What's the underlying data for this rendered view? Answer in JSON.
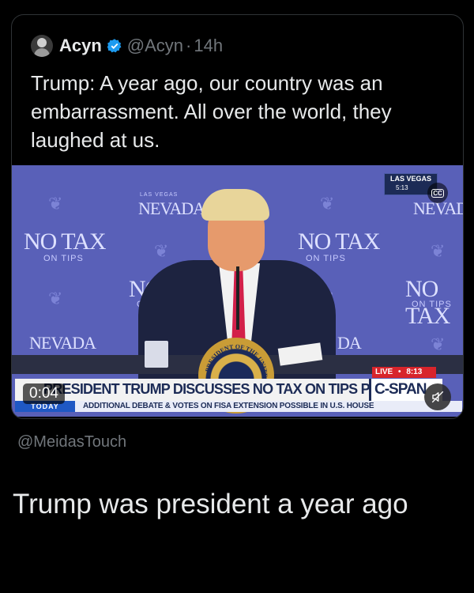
{
  "tweet": {
    "author_name": "Acyn",
    "handle": "@Acyn",
    "separator": "·",
    "time_ago": "14h",
    "text": "Trump: A year ago, our country was an embarrassment. All over the world, they laughed at us."
  },
  "video": {
    "duration": "0:04",
    "background_texts": {
      "nevada_left": "NEVADA",
      "nevada_right": "NEVADA",
      "nevada_bottom_left": "NEVADA",
      "las_vegas_small": "LAS VEGAS",
      "no_tax_left": "NO TAX",
      "no_tax_center": "NO TAX",
      "no_tax_right": "NO TAX",
      "on_tips": "ON TIPS",
      "no_partial": "NO",
      "on_partial": "ON",
      "da_partial": "DA"
    },
    "location_bug": {
      "city": "LAS VEGAS",
      "time": "5:13"
    },
    "cc_label": "CC",
    "live_tag": {
      "label": "LIVE",
      "dot": "•",
      "time": "8:13"
    },
    "chyron": "PRESIDENT TRUMP DISCUSSES NO TAX ON TIPS POLICY",
    "network": "C-SPAN",
    "ticker_tag": "TODAY",
    "ticker_text": "ADDITIONAL DEBATE & VOTES ON FISA EXTENSION POSSIBLE IN U.S. HOUSE",
    "seal_text": "PRESIDENT OF THE UNITED"
  },
  "attribution": "@MeidasTouch",
  "comment": "Trump was president a year ago",
  "colors": {
    "verified_blue": "#1d9bf0",
    "muted_text": "#71767b",
    "card_border": "#2f3336"
  }
}
